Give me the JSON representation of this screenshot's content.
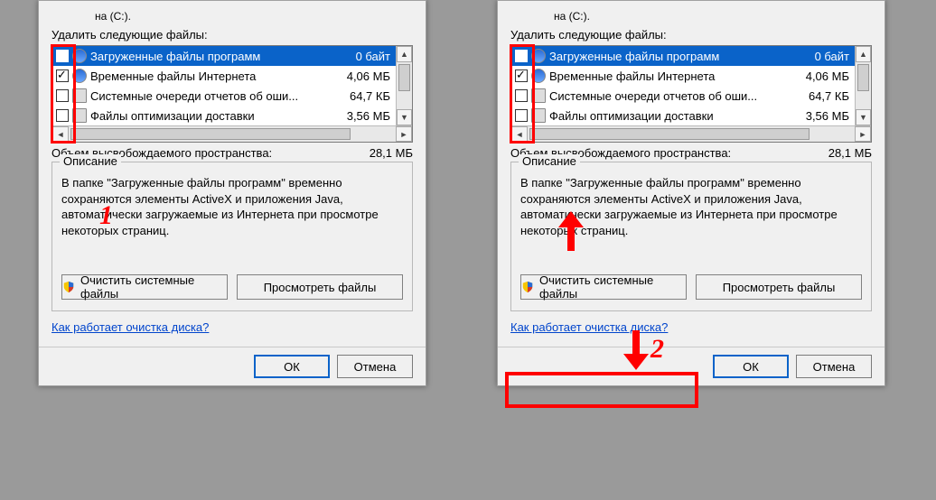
{
  "drive_line": "на (C:).",
  "delete_label": "Удалить следующие файлы:",
  "rows": [
    {
      "name": "Загруженные файлы программ",
      "size": "0 байт",
      "checked": true,
      "selected": true,
      "icon": "globe"
    },
    {
      "name": "Временные файлы Интернета",
      "size": "4,06 МБ",
      "checked": true,
      "selected": false,
      "icon": "globe"
    },
    {
      "name": "Системные очереди отчетов об оши...",
      "size": "64,7 КБ",
      "checked": false,
      "selected": false,
      "icon": "folder"
    },
    {
      "name": "Файлы оптимизации доставки",
      "size": "3,56 МБ",
      "checked": false,
      "selected": false,
      "icon": "folder"
    }
  ],
  "total_label": "Объем высвобождаемого пространства:",
  "total_value": "28,1 МБ",
  "group_title": "Описание",
  "description": "В папке \"Загруженные файлы программ\" временно сохраняются элементы ActiveX и приложения Java, автоматически загружаемые из Интернета при просмотре некоторых страниц.",
  "btn_clean": "Очистить системные файлы",
  "btn_view": "Просмотреть файлы",
  "link_text": "Как работает очистка диска?",
  "ok": "ОК",
  "cancel": "Отмена",
  "ann1": "1",
  "ann2": "2"
}
